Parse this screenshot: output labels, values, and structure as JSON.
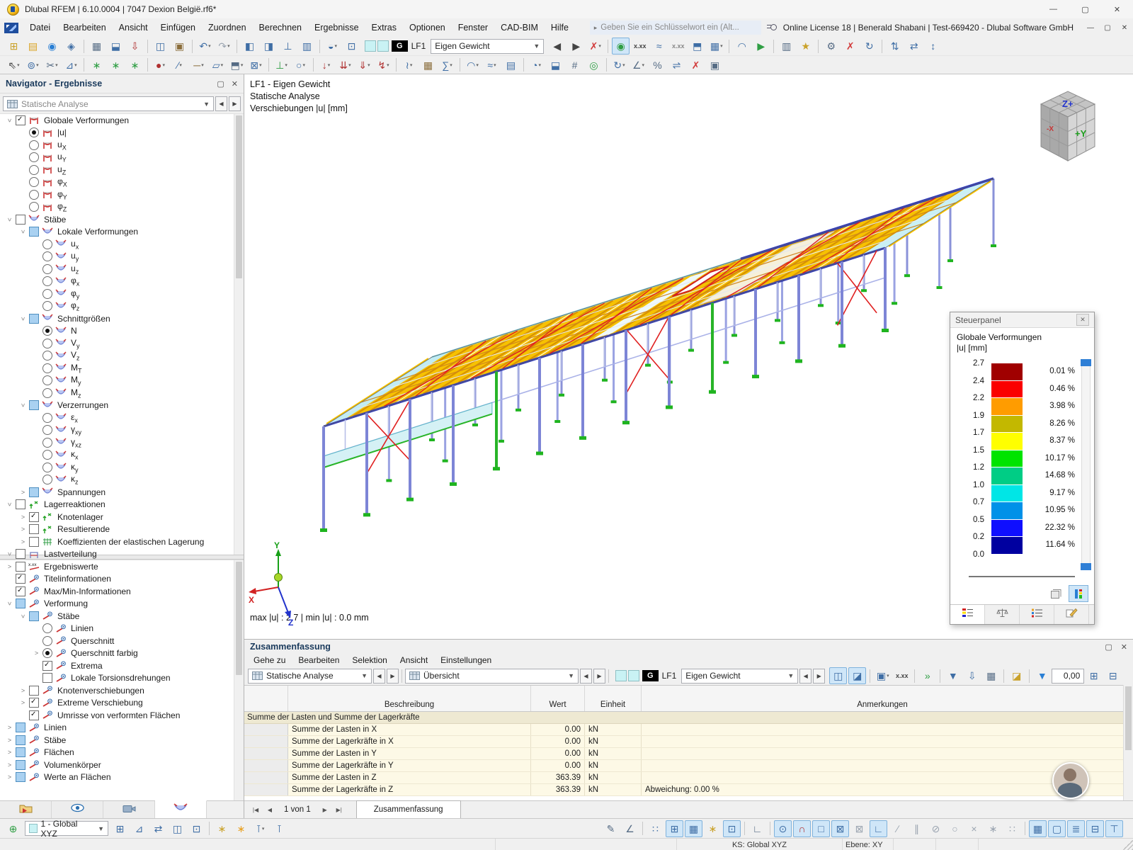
{
  "window": {
    "title": "Dlubal RFEM | 6.10.0004 | 7047 Dexion België.rf6*",
    "license": "Online License 18 | Benerald Shabani | Test-669420 - Dlubal Software GmbH",
    "search_placeholder": "Geben Sie ein Schlüsselwort ein (Alt...",
    "minimize": "—",
    "maximize": "▢",
    "close": "✕"
  },
  "menubar": [
    "Datei",
    "Bearbeiten",
    "Ansicht",
    "Einfügen",
    "Zuordnen",
    "Berechnen",
    "Ergebnisse",
    "Extras",
    "Optionen",
    "Fenster",
    "CAD-BIM",
    "Hilfe"
  ],
  "loadcase": {
    "g": "G",
    "lf": "LF1",
    "name": "Eigen Gewicht"
  },
  "toolbar1a": [
    [
      "new-model",
      "⊞",
      "#caa22a"
    ],
    [
      "open-model",
      "▤",
      "#d9a11f"
    ],
    [
      "dlubal-online",
      "◉",
      "#2a7fd4"
    ],
    [
      "project-navigator",
      "◈",
      "#3f6ea5"
    ],
    "|",
    [
      "print-graphic",
      "▦",
      "#566c85"
    ],
    [
      "save-model",
      "⬓",
      "#3f6ea5"
    ],
    [
      "export-pdf",
      "⇩",
      "#b03030"
    ],
    "|",
    [
      "copy-graphic",
      "◫",
      "#3f6ea5"
    ],
    [
      "clipboard",
      "▣",
      "#8a6d3b"
    ],
    "|",
    [
      "undo",
      "↶",
      "#3f6ea5",
      "d"
    ],
    [
      "redo",
      "↷",
      "#9aa4b0",
      "d"
    ],
    "|",
    [
      "table-manager",
      "◧",
      "#3f6ea5"
    ],
    [
      "table-split",
      "◨",
      "#3f6ea5"
    ],
    [
      "ruler",
      "⊥",
      "#3f6ea5"
    ],
    [
      "display-properties",
      "▥",
      "#3f6ea5"
    ],
    "|",
    [
      "render-mode",
      "◒",
      "#3f6ea5",
      "d"
    ],
    [
      "isometric-view",
      "⊡",
      "#3f6ea5"
    ]
  ],
  "toolbar1b": [
    [
      "previous-loadcase",
      "◀",
      "#444"
    ],
    [
      "next-loadcase",
      "▶",
      "#444"
    ],
    [
      "filter-results",
      "✗",
      "#d23b3b",
      "d"
    ],
    "|",
    [
      "show-results",
      "◉",
      "#2f9e44",
      "a"
    ],
    [
      "result-values",
      "x.xx",
      "#444",
      "t"
    ],
    [
      "deformation-display",
      "≈",
      "#3f6ea5"
    ],
    [
      "result-values-surfaces",
      "x.xx",
      "#888",
      "t"
    ],
    [
      "clipping-box",
      "⬒",
      "#3f6ea5"
    ],
    [
      "result-tables",
      "▦",
      "#3f6ea5",
      "d"
    ],
    "|",
    [
      "result-diagram",
      "◠",
      "#3f6ea5"
    ],
    [
      "animation",
      "▶",
      "#2f9e44"
    ],
    "|",
    [
      "printout-report",
      "▥",
      "#566c85"
    ],
    [
      "report-template",
      "★",
      "#caa22a"
    ],
    "|",
    [
      "settings",
      "⚙",
      "#566c85"
    ],
    [
      "delete-results",
      "✗",
      "#d23b3b"
    ],
    [
      "recalculate",
      "↻",
      "#3f6ea5"
    ],
    "|",
    [
      "sort-vertical",
      "⇅",
      "#3f6ea5"
    ],
    [
      "sort-horizontal",
      "⇄",
      "#3f6ea5"
    ],
    [
      "reorder",
      "↕",
      "#3f6ea5"
    ]
  ],
  "toolbar2": [
    [
      "edit-select",
      "⇖",
      "#444",
      "d"
    ],
    [
      "select-special",
      "⊚",
      "#3f6ea5",
      "d"
    ],
    [
      "trim",
      "✂",
      "#566c85",
      "d"
    ],
    [
      "split-member",
      "⊿",
      "#3f6ea5",
      "d"
    ],
    "|",
    [
      "generate-model",
      "∗",
      "#2f9e44"
    ],
    [
      "generate-surfaces",
      "∗",
      "#2f9e44"
    ],
    [
      "generate-members",
      "∗",
      "#2f9e44"
    ],
    "|",
    [
      "node",
      "●",
      "#b03030",
      "d"
    ],
    [
      "line",
      "∕",
      "#3f6ea5",
      "d"
    ],
    [
      "member",
      "─",
      "#8a6d3b",
      "d"
    ],
    [
      "surface",
      "▱",
      "#3f6ea5",
      "d"
    ],
    [
      "solid",
      "⬒",
      "#566c85",
      "d"
    ],
    [
      "opening",
      "⊠",
      "#3f6ea5",
      "d"
    ],
    "|",
    [
      "nodal-support",
      "⊥",
      "#2f9e44",
      "d"
    ],
    [
      "member-hinge",
      "○",
      "#3f6ea5",
      "d"
    ],
    "|",
    [
      "nodal-load",
      "↓",
      "#b03030",
      "d"
    ],
    [
      "member-load",
      "⇊",
      "#b03030",
      "d"
    ],
    [
      "surface-load",
      "⇓",
      "#b03030",
      "d"
    ],
    [
      "free-load",
      "↯",
      "#b03030",
      "d"
    ],
    "|",
    [
      "imperfection",
      "≀",
      "#3f6ea5",
      "d"
    ],
    [
      "mesh-settings",
      "▦",
      "#8a6d3b"
    ],
    [
      "calculate-all",
      "∑",
      "#3f6ea5",
      "d"
    ],
    "|",
    [
      "result-beams",
      "◠",
      "#3f6ea5",
      "d"
    ],
    [
      "smooth-results",
      "≈",
      "#3f6ea5",
      "d"
    ],
    [
      "result-grids",
      "▤",
      "#3f6ea5"
    ],
    "|",
    [
      "visibilities",
      "◔",
      "#3f6ea5",
      "d"
    ],
    [
      "user-view",
      "⬓",
      "#3f6ea5"
    ],
    [
      "numbering",
      "#",
      "#566c85"
    ],
    [
      "show-all",
      "◎",
      "#2f9e44"
    ],
    "|",
    [
      "renumber",
      "↻",
      "#3f6ea5",
      "d"
    ],
    [
      "measure",
      "∠",
      "#566c85",
      "d"
    ],
    [
      "percent",
      "%",
      "#566c85"
    ],
    [
      "mirror",
      "⇌",
      "#3f6ea5"
    ],
    [
      "delete-objects",
      "✗",
      "#d23b3b"
    ],
    [
      "screenshot",
      "▣",
      "#566c85"
    ]
  ],
  "navigator": {
    "title": "Navigator - Ergebnisse",
    "combo": "Statische Analyse",
    "float_icon": "▢",
    "close_icon": "✕",
    "tree_upper": [
      [
        0,
        "v",
        "cb",
        1,
        "frame",
        "Globale Verformungen",
        ""
      ],
      [
        1,
        "",
        "rs",
        0,
        "frame",
        "|u|",
        ""
      ],
      [
        1,
        "",
        "r",
        0,
        "frame",
        "u",
        "X"
      ],
      [
        1,
        "",
        "r",
        0,
        "frame",
        "u",
        "Y"
      ],
      [
        1,
        "",
        "r",
        0,
        "frame",
        "u",
        "Z"
      ],
      [
        1,
        "",
        "r",
        0,
        "frame",
        "φ",
        "X"
      ],
      [
        1,
        "",
        "r",
        0,
        "frame",
        "φ",
        "Y"
      ],
      [
        1,
        "",
        "r",
        0,
        "frame",
        "φ",
        "Z"
      ],
      [
        0,
        "v",
        "cb",
        0,
        "beam",
        "Stäbe",
        ""
      ],
      [
        1,
        "v",
        "cbf",
        0,
        "beam",
        "Lokale Verformungen",
        ""
      ],
      [
        2,
        "",
        "r",
        0,
        "beam",
        "u",
        "x"
      ],
      [
        2,
        "",
        "r",
        0,
        "beam",
        "u",
        "y"
      ],
      [
        2,
        "",
        "r",
        0,
        "beam",
        "u",
        "z"
      ],
      [
        2,
        "",
        "r",
        0,
        "beam",
        "φ",
        "x"
      ],
      [
        2,
        "",
        "r",
        0,
        "beam",
        "φ",
        "y"
      ],
      [
        2,
        "",
        "r",
        0,
        "beam",
        "φ",
        "z"
      ],
      [
        1,
        "v",
        "cbf",
        0,
        "beam",
        "Schnittgrößen",
        ""
      ],
      [
        2,
        "",
        "rs",
        0,
        "beam",
        "N",
        ""
      ],
      [
        2,
        "",
        "r",
        0,
        "beam",
        "V",
        "y"
      ],
      [
        2,
        "",
        "r",
        0,
        "beam",
        "V",
        "z"
      ],
      [
        2,
        "",
        "r",
        0,
        "beam",
        "M",
        "T"
      ],
      [
        2,
        "",
        "r",
        0,
        "beam",
        "M",
        "y"
      ],
      [
        2,
        "",
        "r",
        0,
        "beam",
        "M",
        "z"
      ],
      [
        1,
        "v",
        "cbf",
        0,
        "beam",
        "Verzerrungen",
        ""
      ],
      [
        2,
        "",
        "r",
        0,
        "beam",
        "ε",
        "x"
      ],
      [
        2,
        "",
        "r",
        0,
        "beam",
        "γ",
        "xy"
      ],
      [
        2,
        "",
        "r",
        0,
        "beam",
        "γ",
        "xz"
      ],
      [
        2,
        "",
        "r",
        0,
        "beam",
        "κ",
        "x"
      ],
      [
        2,
        "",
        "r",
        0,
        "beam",
        "κ",
        "y"
      ],
      [
        2,
        "",
        "r",
        0,
        "beam",
        "κ",
        "z"
      ],
      [
        1,
        ">",
        "cbf",
        0,
        "beam",
        "Spannungen",
        ""
      ],
      [
        0,
        "v",
        "cb",
        0,
        "support",
        "Lagerreaktionen",
        ""
      ],
      [
        1,
        ">",
        "cb",
        1,
        "support",
        "Knotenlager",
        ""
      ],
      [
        1,
        ">",
        "cb",
        0,
        "support",
        "Resultierende",
        ""
      ],
      [
        1,
        ">",
        "cb",
        0,
        "coeff",
        "Koeffizienten der elastischen Lagerung",
        ""
      ],
      [
        0,
        "v",
        "cb",
        0,
        "lastv",
        "Lastverteilung",
        ""
      ]
    ],
    "tree_lower": [
      [
        0,
        ">",
        "cb",
        0,
        "xxx",
        "Ergebniswerte",
        ""
      ],
      [
        0,
        "",
        "cb",
        1,
        "disp",
        "Titelinformationen",
        ""
      ],
      [
        0,
        "",
        "cb",
        1,
        "disp",
        "Max/Min-Informationen",
        ""
      ],
      [
        0,
        "v",
        "cbf",
        0,
        "disp",
        "Verformung",
        ""
      ],
      [
        1,
        "v",
        "cbf",
        0,
        "disp",
        "Stäbe",
        ""
      ],
      [
        2,
        "",
        "r",
        0,
        "disp",
        "Linien",
        ""
      ],
      [
        2,
        "",
        "r",
        0,
        "disp",
        "Querschnitt",
        ""
      ],
      [
        2,
        ">",
        "rs",
        0,
        "disp",
        "Querschnitt farbig",
        ""
      ],
      [
        2,
        "",
        "cb",
        1,
        "disp",
        "Extrema",
        ""
      ],
      [
        2,
        "",
        "cb",
        0,
        "disp",
        "Lokale Torsionsdrehungen",
        ""
      ],
      [
        1,
        ">",
        "cb",
        0,
        "disp",
        "Knotenverschiebungen",
        ""
      ],
      [
        1,
        ">",
        "cb",
        1,
        "disp",
        "Extreme Verschiebung",
        ""
      ],
      [
        1,
        "",
        "cb",
        1,
        "disp",
        "Umrisse von verformten Flächen",
        ""
      ],
      [
        0,
        ">",
        "cbf",
        0,
        "disp",
        "Linien",
        ""
      ],
      [
        0,
        ">",
        "cbf",
        0,
        "disp",
        "Stäbe",
        ""
      ],
      [
        0,
        ">",
        "cbf",
        0,
        "disp",
        "Flächen",
        ""
      ],
      [
        0,
        ">",
        "cbf",
        0,
        "disp",
        "Volumenkörper",
        ""
      ],
      [
        0,
        ">",
        "cbf",
        0,
        "disp",
        "Werte an Flächen",
        ""
      ]
    ],
    "tabs": [
      "data-navigator",
      "display-navigator",
      "views-navigator",
      "results-navigator"
    ]
  },
  "viewport": {
    "annotation": [
      "LF1 - Eigen Gewicht",
      "Statische Analyse",
      "Verschiebungen |u| [mm]"
    ],
    "maxmin": "max |u| : 2.7 | min |u| : 0.0 mm",
    "axis": {
      "x": "X",
      "y": "Y",
      "z": "Z"
    },
    "cube": {
      "top": "Z+",
      "front": "+Y",
      "side": "-X"
    }
  },
  "panel": {
    "title": "Steuerpanel",
    "close_icon": "✕",
    "subtitle1": "Globale Verformungen",
    "subtitle2": "|u| [mm]",
    "legend": {
      "values": [
        "2.7",
        "2.4",
        "2.2",
        "1.9",
        "1.7",
        "1.5",
        "1.2",
        "1.0",
        "0.7",
        "0.5",
        "0.2",
        "0.0"
      ],
      "colors": [
        "#a00000",
        "#fa0000",
        "#ff9c00",
        "#c3b800",
        "#ffff00",
        "#00e400",
        "#00cd85",
        "#00e6e6",
        "#0091e8",
        "#0f0fff",
        "#0000a0"
      ],
      "percents": [
        "0.01 %",
        "0.46 %",
        "3.98 %",
        "8.26 %",
        "8.37 %",
        "10.17 %",
        "14.68 %",
        "9.17 %",
        "10.95 %",
        "22.32 %",
        "11.64 %"
      ]
    },
    "tabs": [
      "color-scale-tab",
      "pan-compare-tab",
      "factors-tab",
      "filter-edit-tab"
    ]
  },
  "summary": {
    "title": "Zusammenfassung",
    "float_icon": "▢",
    "close_icon": "✕",
    "menu": [
      "Gehe zu",
      "Bearbeiten",
      "Selektion",
      "Ansicht",
      "Einstellungen"
    ],
    "combo1": "Statische Analyse",
    "combo2": "Übersicht",
    "calc_time": "0,00",
    "icons": [
      [
        "sync-selection",
        "◫",
        "#3f6ea5",
        "a"
      ],
      [
        "sync-tables",
        "◪",
        "#3f6ea5",
        "a"
      ],
      "|",
      [
        "table-settings",
        "▣",
        "#3f6ea5",
        "d"
      ],
      [
        "table-values",
        "x.xx",
        "#444",
        "t"
      ],
      "|",
      [
        "go-to-object",
        "»",
        "#2f9e44"
      ],
      "|",
      [
        "table-filter",
        "▼",
        "#3f6ea5"
      ],
      [
        "table-export",
        "⇩",
        "#3f6ea5"
      ],
      [
        "table-print",
        "▦",
        "#566c85"
      ],
      "|",
      [
        "chart-view",
        "◪",
        "#caa22a"
      ],
      "|",
      [
        "result-filter",
        "▼",
        "#2a7fd4"
      ]
    ],
    "icons_tail": [
      [
        "table-new",
        "⊞",
        "#3f6ea5"
      ],
      [
        "table-close",
        "⊟",
        "#3f6ea5"
      ]
    ],
    "table": {
      "headers": [
        "",
        "Beschreibung",
        "Wert",
        "Einheit",
        "Anmerkungen"
      ],
      "section": "Summe der Lasten und Summe der Lagerkräfte",
      "rows": [
        [
          "Summe der Lasten in X",
          "0.00",
          "kN",
          ""
        ],
        [
          "Summe der Lagerkräfte in X",
          "0.00",
          "kN",
          ""
        ],
        [
          "Summe der Lasten in Y",
          "0.00",
          "kN",
          ""
        ],
        [
          "Summe der Lagerkräfte in Y",
          "0.00",
          "kN",
          ""
        ],
        [
          "Summe der Lasten in Z",
          "363.39",
          "kN",
          ""
        ],
        [
          "Summe der Lagerkräfte in Z",
          "363.39",
          "kN",
          "Abweichung: 0.00 %"
        ]
      ]
    },
    "pager": {
      "first": "|◀",
      "prev": "◀",
      "label": "1 von 1",
      "next": "▶",
      "last": "▶|"
    },
    "tab": "Zusammenfassung"
  },
  "bottombar": {
    "cs_icon": [
      [
        "coordinate-system",
        "⊕",
        "#2f9e44"
      ]
    ],
    "combo": "1 - Global XYZ",
    "icons_mid": [
      [
        "new-workplane",
        "⊞",
        "#3f6ea5"
      ],
      [
        "rotate-workplane",
        "⊿",
        "#3f6ea5"
      ],
      [
        "move-workplane",
        "⇄",
        "#3f6ea5"
      ],
      [
        "copy-workplane",
        "◫",
        "#3f6ea5"
      ],
      [
        "workplane-3d",
        "⊡",
        "#3f6ea5"
      ],
      "|",
      [
        "new-guideline",
        "∗",
        "#caa22a"
      ],
      [
        "edit-guidelines",
        "∗",
        "#e8a020"
      ],
      [
        "snap-x",
        "⊺",
        "#3f6ea5",
        "d"
      ],
      [
        "snap-xx",
        "⊺",
        "#3f6ea5"
      ]
    ],
    "icons_right": [
      [
        "pencil-edit",
        "✎",
        "#566c85"
      ],
      [
        "polyline-edit",
        "∠",
        "#566c85"
      ],
      "|",
      [
        "grid-points",
        "∷",
        "#3f6ea5"
      ],
      [
        "new-grid",
        "⊞",
        "#3f6ea5",
        "a"
      ],
      [
        "show-grid",
        "▦",
        "#3f6ea5",
        "a"
      ],
      [
        "new-snap",
        "∗",
        "#caa22a"
      ],
      [
        "object-snap",
        "⊡",
        "#3f6ea5",
        "a"
      ],
      "|",
      [
        "ortho-mode",
        "∟",
        "#566c85"
      ],
      "|",
      [
        "snap-nodes",
        "⊙",
        "#3f6ea5",
        "a"
      ],
      [
        "snap-magnet",
        "∩",
        "#b03030",
        "a"
      ],
      [
        "snap-rectangle",
        "□",
        "#3f6ea5",
        "a"
      ],
      [
        "snap-circle",
        "⊠",
        "#3f6ea5",
        "a"
      ],
      [
        "snap-ellipse",
        "⊠",
        "#9aa4b0"
      ],
      [
        "snap-corner",
        "∟",
        "#3f6ea5",
        "a"
      ],
      [
        "snap-line",
        "∕",
        "#9aa4b0"
      ],
      [
        "snap-parallel",
        "∥",
        "#9aa4b0"
      ],
      [
        "snap-perpendicular",
        "⊘",
        "#9aa4b0"
      ],
      [
        "snap-tangent",
        "○",
        "#9aa4b0"
      ],
      [
        "snap-intersection",
        "×",
        "#9aa4b0"
      ],
      [
        "snap-midpoint",
        "∗",
        "#9aa4b0"
      ],
      [
        "snap-division",
        "∷",
        "#9aa4b0"
      ],
      "|",
      [
        "background-grid",
        "▦",
        "#3f6ea5",
        "a"
      ],
      [
        "selection-window",
        "▢",
        "#3f6ea5",
        "a"
      ],
      [
        "layers-toggle",
        "≣",
        "#3f6ea5",
        "a"
      ],
      [
        "sections-toggle",
        "⊟",
        "#3f6ea5",
        "a"
      ],
      [
        "pins-toggle",
        "⊤",
        "#3f6ea5",
        "a"
      ]
    ]
  },
  "statusbar": {
    "ks": "KS: Global XYZ",
    "ebene": "Ebene: XY"
  }
}
